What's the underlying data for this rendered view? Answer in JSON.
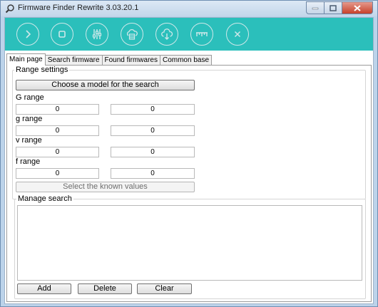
{
  "window": {
    "title": "Firmware Finder Rewrite 3.03.20.1"
  },
  "colors": {
    "toolbar": "#2bbfbb",
    "title_bar": "#c3d6ea",
    "close_button": "#c7412b"
  },
  "toolbar": {
    "buttons": [
      {
        "icon": "play-icon"
      },
      {
        "icon": "stop-icon"
      },
      {
        "icon": "sliders-icon"
      },
      {
        "icon": "cloud-server-icon"
      },
      {
        "icon": "cloud-download-icon"
      },
      {
        "icon": "ruler-icon"
      },
      {
        "icon": "close-circle-icon"
      }
    ]
  },
  "tabs": [
    "Main page",
    "Search firmware",
    "Found firmwares",
    "Common base"
  ],
  "range_settings": {
    "title": "Range settings",
    "choose_model_button": "Choose a model for the search",
    "ranges": [
      {
        "label": "G range",
        "from": "0",
        "to": "0"
      },
      {
        "label": "g range",
        "from": "0",
        "to": "0"
      },
      {
        "label": "v range",
        "from": "0",
        "to": "0"
      },
      {
        "label": "f range",
        "from": "0",
        "to": "0"
      }
    ],
    "known_values_button": "Select the known values"
  },
  "manage_search": {
    "title": "Manage search",
    "add_button": "Add",
    "delete_button": "Delete",
    "clear_button": "Clear"
  }
}
